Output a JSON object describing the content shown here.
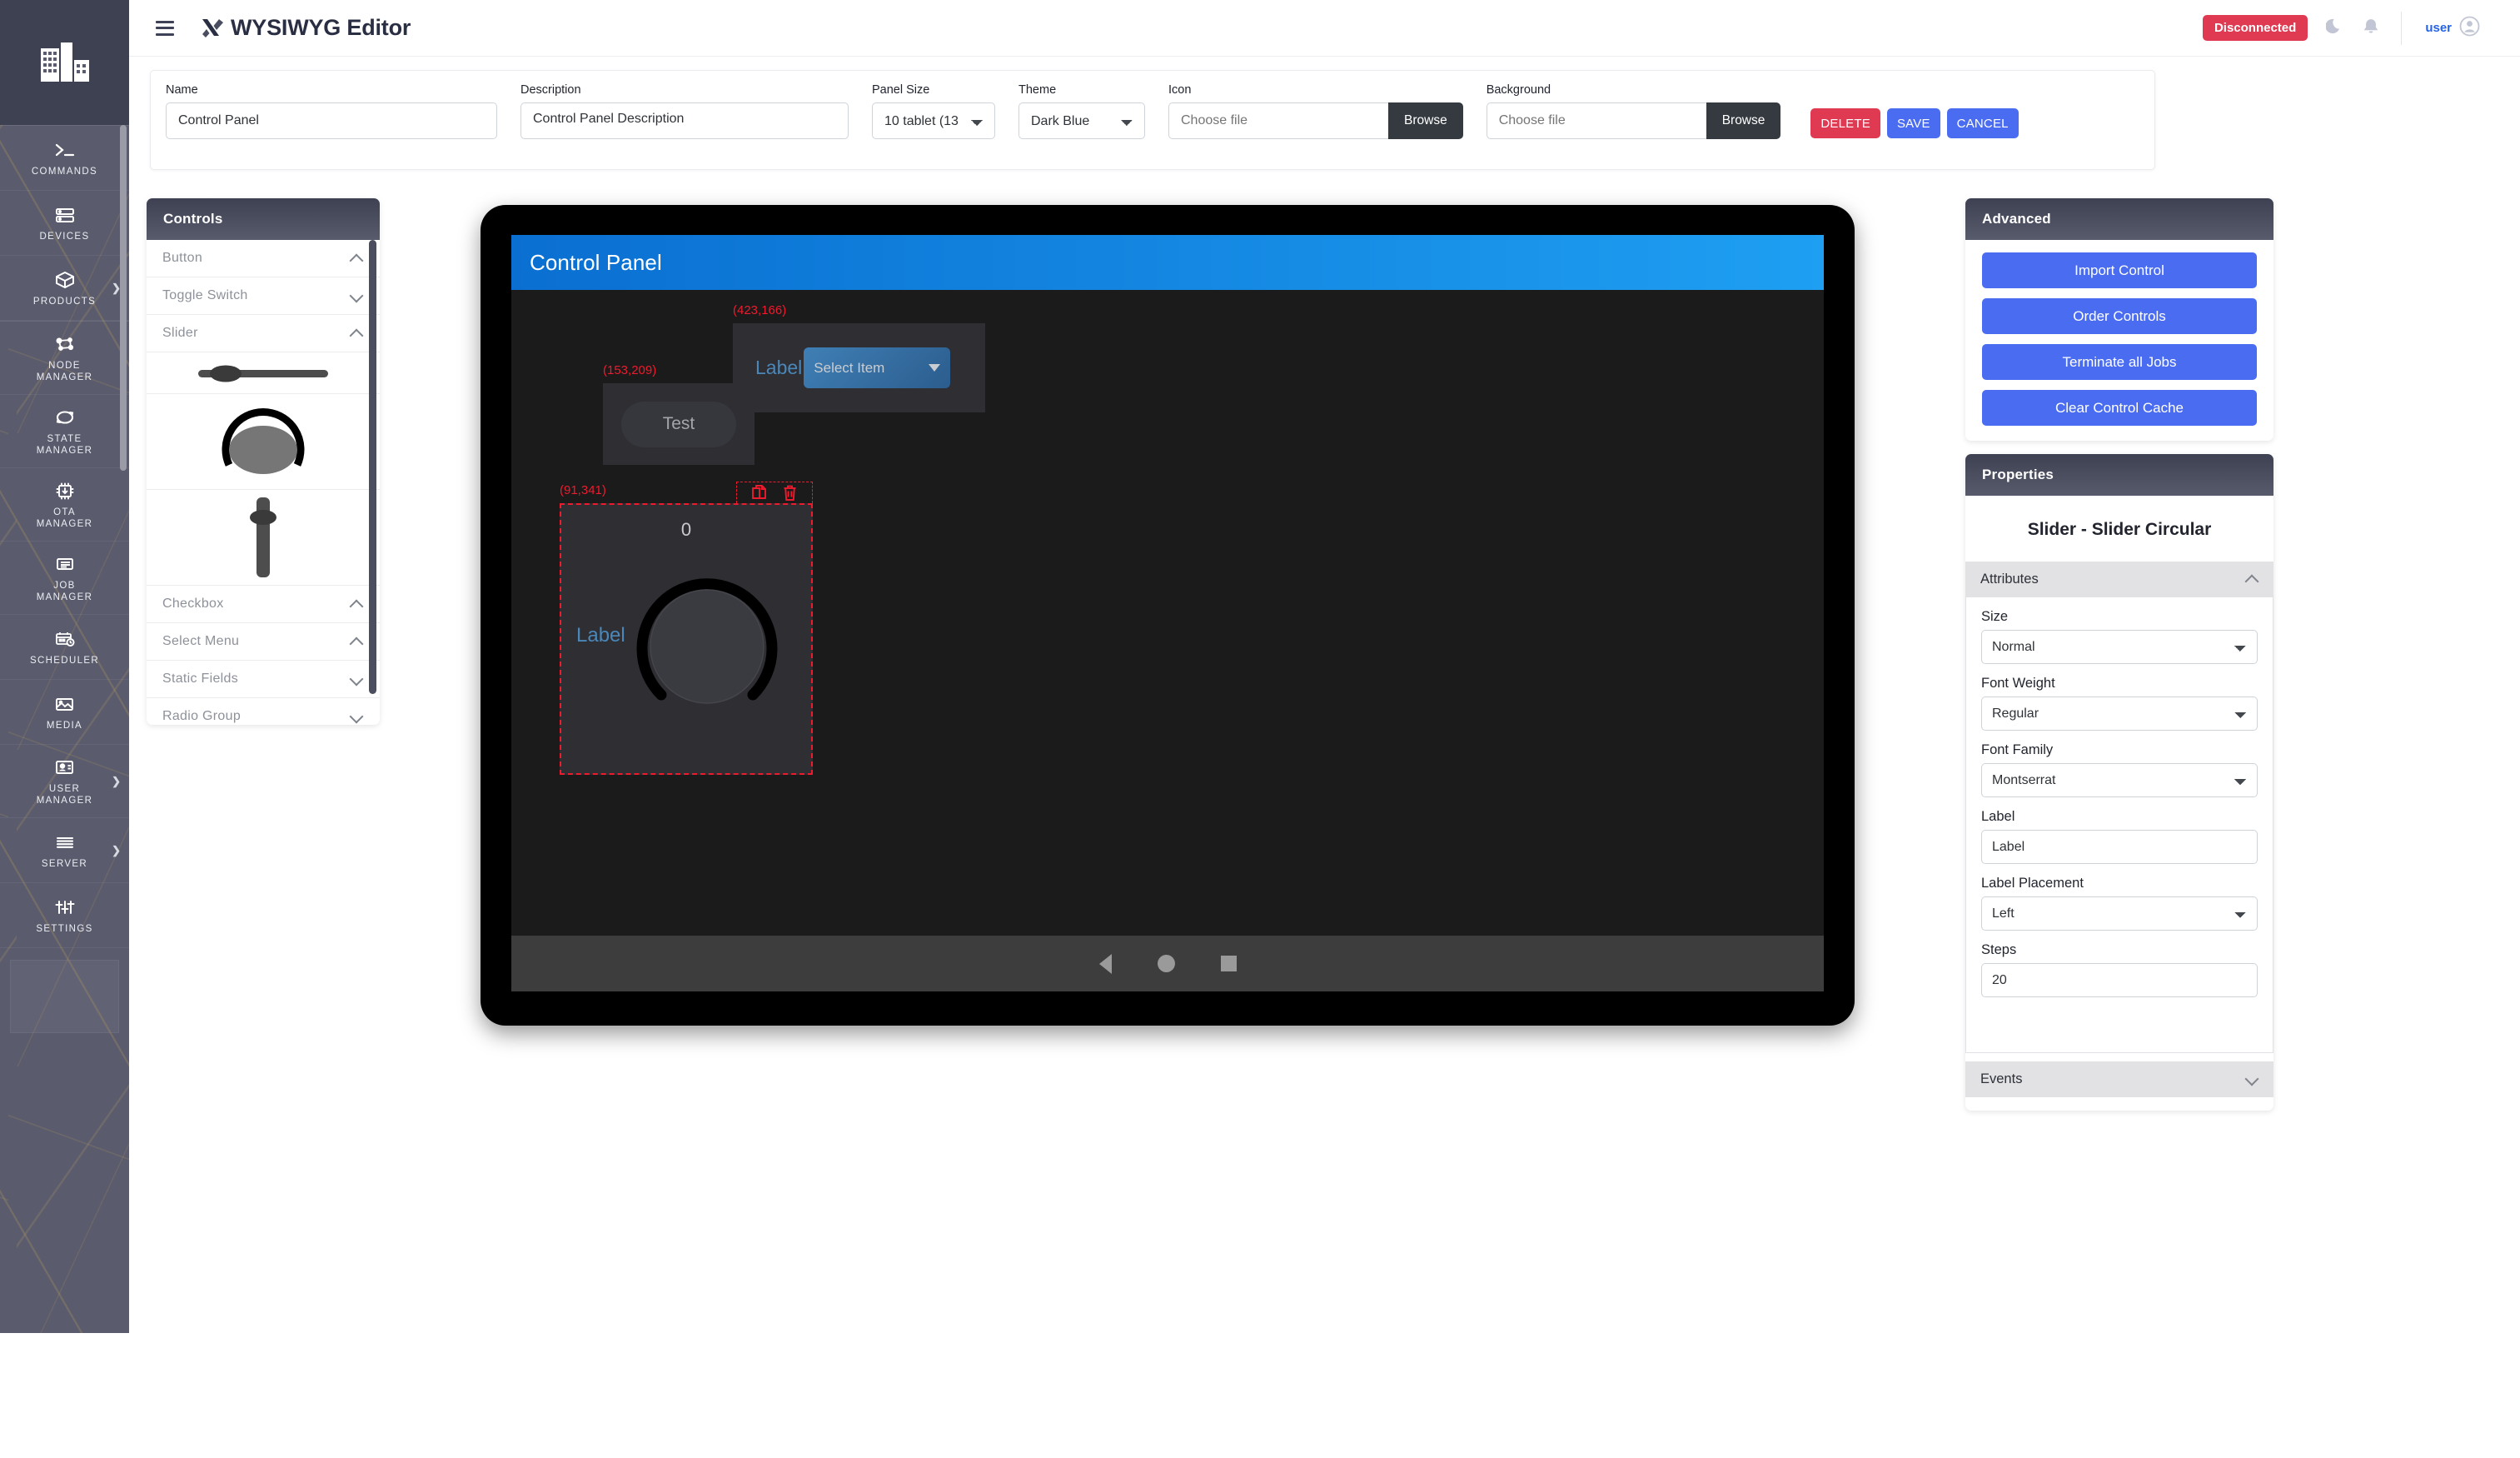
{
  "sidebar": {
    "logo": "building-logo-icon",
    "items": [
      {
        "label": "COMMANDS",
        "icon": "terminal-prompt-icon",
        "expandable": false
      },
      {
        "label": "DEVICES",
        "icon": "server-rack-icon",
        "expandable": false
      },
      {
        "label": "PRODUCTS",
        "icon": "box-package-icon",
        "expandable": true
      },
      {
        "label": "NODE\nMANAGER",
        "icon": "node-network-icon",
        "expandable": false
      },
      {
        "label": "STATE\nMANAGER",
        "icon": "refresh-cycle-icon",
        "expandable": false
      },
      {
        "label": "OTA\nMANAGER",
        "icon": "chip-download-icon",
        "expandable": false
      },
      {
        "label": "JOB\nMANAGER",
        "icon": "job-list-icon",
        "expandable": false
      },
      {
        "label": "SCHEDULER",
        "icon": "calendar-clock-icon",
        "expandable": false
      },
      {
        "label": "MEDIA",
        "icon": "image-picture-icon",
        "expandable": false
      },
      {
        "label": "USER\nMANAGER",
        "icon": "user-card-icon",
        "expandable": true
      },
      {
        "label": "SERVER",
        "icon": "server-lines-icon",
        "expandable": true
      },
      {
        "label": "SETTINGS",
        "icon": "sliders-icon",
        "expandable": false
      }
    ]
  },
  "header": {
    "menu_icon": "hamburger-icon",
    "brand_icon": "wysiwyg-logo-icon",
    "title": "WYSIWYG Editor",
    "connection_status": "Disconnected",
    "connection_color": "#e03a52",
    "theme_toggle_icon": "moon-icon",
    "notifications_icon": "bell-icon",
    "user_name": "user",
    "user_avatar_icon": "user-avatar-icon",
    "user_name_color": "#2563eb"
  },
  "form": {
    "name": {
      "label": "Name",
      "value": "Control Panel"
    },
    "description": {
      "label": "Description",
      "value": "Control Panel Description"
    },
    "panel_size": {
      "label": "Panel Size",
      "value": "10 tablet (13"
    },
    "theme": {
      "label": "Theme",
      "value": "Dark Blue"
    },
    "icon": {
      "label": "Icon",
      "value": "",
      "placeholder": "Choose file",
      "browse_label": "Browse"
    },
    "background": {
      "label": "Background",
      "value": "",
      "placeholder": "Choose file",
      "browse_label": "Browse"
    },
    "delete_label": "DELETE",
    "save_label": "SAVE",
    "cancel_label": "CANCEL",
    "delete_color": "#e03a52",
    "save_color": "#4a6cf0"
  },
  "controls_panel": {
    "title": "Controls",
    "items": [
      {
        "label": "Button",
        "state": "expanded"
      },
      {
        "label": "Toggle Switch",
        "state": "collapsed"
      },
      {
        "label": "Slider",
        "state": "expanded"
      },
      {
        "label": "Checkbox",
        "state": "expanded"
      },
      {
        "label": "Select Menu",
        "state": "expanded"
      },
      {
        "label": "Static Fields",
        "state": "collapsed"
      },
      {
        "label": "Radio Group",
        "state": "collapsed"
      }
    ],
    "slider_previews": [
      "slider-horizontal-preview",
      "slider-circular-preview",
      "slider-vertical-preview"
    ]
  },
  "canvas": {
    "panel_title": "Control Panel",
    "title_gradient_from": "#0a6fd1",
    "title_gradient_to": "#1e9ff2",
    "widgets": [
      {
        "type": "button",
        "coord": "(153,209)",
        "label": "Test",
        "selected": false
      },
      {
        "type": "select-menu",
        "coord": "(423,166)",
        "label": "Label",
        "value": "Select Item",
        "selected": false
      },
      {
        "type": "slider-circular",
        "coord": "(91,341)",
        "label": "Label",
        "value": "0",
        "selected": true,
        "toolbar": [
          "copy-icon",
          "delete-icon"
        ]
      }
    ],
    "android_nav": [
      "back-triangle-icon",
      "home-circle-icon",
      "recents-square-icon"
    ]
  },
  "advanced": {
    "title": "Advanced",
    "buttons": [
      "Import Control",
      "Order Controls",
      "Terminate all Jobs",
      "Clear Control Cache"
    ],
    "button_color": "#4a6cf0"
  },
  "properties": {
    "title": "Properties",
    "subject": "Slider - Slider Circular",
    "attributes_label": "Attributes",
    "attributes_state": "expanded",
    "fields": [
      {
        "label": "Size",
        "value": "Normal",
        "kind": "select"
      },
      {
        "label": "Font Weight",
        "value": "Regular",
        "kind": "select"
      },
      {
        "label": "Font Family",
        "value": "Montserrat",
        "kind": "select"
      },
      {
        "label": "Label",
        "value": "Label",
        "kind": "text"
      },
      {
        "label": "Label Placement",
        "value": "Left",
        "kind": "select"
      },
      {
        "label": "Steps",
        "value": "20",
        "kind": "text"
      }
    ],
    "events_label": "Events",
    "events_state": "collapsed"
  }
}
